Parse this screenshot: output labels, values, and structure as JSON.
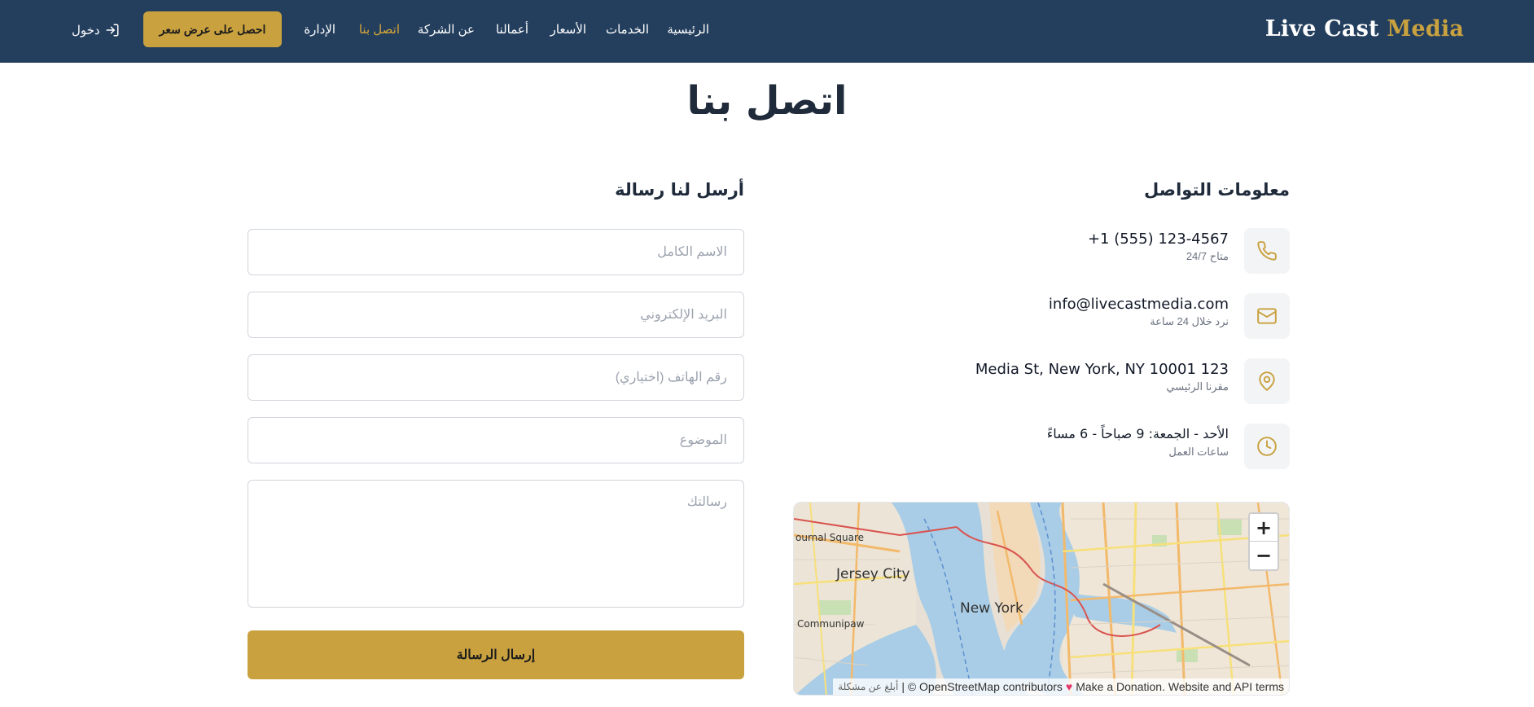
{
  "navbar": {
    "brand_main": "Live Cast",
    "brand_accent": "Media",
    "links": {
      "home": "الرئيسية",
      "services": "الخدمات",
      "pricing": "الأسعار",
      "portfolio": "أعمالنا",
      "about": "عن الشركة",
      "contact": "اتصل بنا",
      "admin": "الإدارة"
    },
    "quote_button": "احصل على عرض سعر",
    "login_label": "دخول"
  },
  "page": {
    "title": "اتصل بنا"
  },
  "contact_info": {
    "heading": "معلومات التواصل",
    "items": [
      {
        "icon": "phone-icon",
        "main": "+1 (555) 123-4567",
        "sub": "متاح 24/7"
      },
      {
        "icon": "mail-icon",
        "main": "info@livecastmedia.com",
        "sub": "نرد خلال 24 ساعة"
      },
      {
        "icon": "map-pin-icon",
        "main": "123 Media St, New York, NY 10001",
        "sub": "مقرنا الرئيسي"
      },
      {
        "icon": "clock-icon",
        "main": "الأحد - الجمعة: 9 صباحاً - 6 مساءً",
        "sub": "ساعات العمل"
      }
    ]
  },
  "map": {
    "labels": {
      "journal_square": "ournal Square",
      "jersey_city": "Jersey City",
      "new_york": "New York",
      "communipaw": "Communipaw"
    },
    "zoom_in": "+",
    "zoom_out": "−",
    "attribution_report": "أبلغ عن مشكلة",
    "attribution_osm": "| © OpenStreetMap contributors",
    "attribution_heart": "♥",
    "attribution_donation": "Make a Donation. Website and API terms"
  },
  "form": {
    "heading": "أرسل لنا رسالة",
    "name_placeholder": "الاسم الكامل",
    "email_placeholder": "البريد الإلكتروني",
    "phone_placeholder": "رقم الهاتف (اختياري)",
    "subject_placeholder": "الموضوع",
    "message_placeholder": "رسالتك",
    "submit_label": "إرسال الرسالة"
  },
  "colors": {
    "navbar_bg": "#243f5e",
    "accent": "#c9a13f",
    "icon_accent": "#c9a13f"
  }
}
